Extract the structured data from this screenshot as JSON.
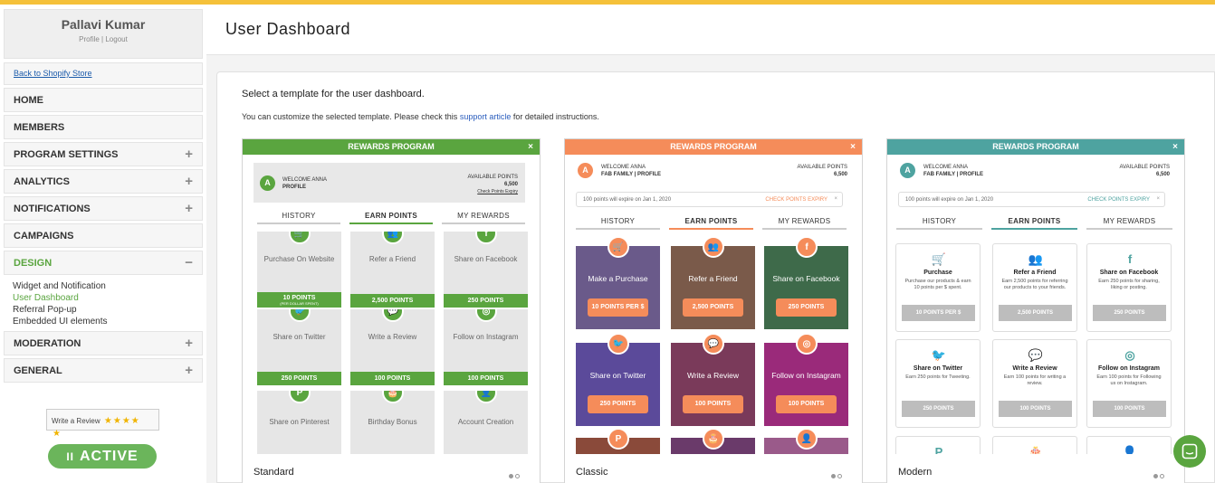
{
  "user": {
    "name": "Pallavi Kumar",
    "links": "Profile | Logout"
  },
  "sidebar": {
    "back": "Back to Shopify Store",
    "items": [
      {
        "label": "HOME",
        "pm": ""
      },
      {
        "label": "MEMBERS",
        "pm": ""
      },
      {
        "label": "PROGRAM SETTINGS",
        "pm": "+"
      },
      {
        "label": "ANALYTICS",
        "pm": "+"
      },
      {
        "label": "NOTIFICATIONS",
        "pm": "+"
      },
      {
        "label": "CAMPAIGNS",
        "pm": ""
      },
      {
        "label": "DESIGN",
        "pm": "−"
      },
      {
        "label": "MODERATION",
        "pm": "+"
      },
      {
        "label": "GENERAL",
        "pm": "+"
      }
    ],
    "design_sub": [
      "Widget and Notification",
      "User Dashboard",
      "Referral Pop-up",
      "Embedded UI elements"
    ],
    "review": "Write a Review",
    "review_stars": "★★★★",
    "review_star5": "★",
    "active": "ACTIVE",
    "active_icon": "II"
  },
  "header": {
    "title": "User Dashboard"
  },
  "panel": {
    "select": "Select a template for the user dashboard.",
    "desc_pre": "You can customize the selected template. Please check this ",
    "desc_link": "support article",
    "desc_post": " for detailed instructions."
  },
  "preview": {
    "rewards": "REWARDS PROGRAM",
    "close": "×",
    "welcome": "WELCOME ANNA",
    "profile": "PROFILE",
    "fab_profile": "FAB FAMILY | PROFILE",
    "avail": "AVAILABLE POINTS",
    "points": "6,500",
    "check": "Check Points Expiry",
    "expiry": "100 points will expire on Jan 1, 2020",
    "check_exp": "CHECK POINTS EXPIRY",
    "avatar": "A",
    "tabs": [
      "HISTORY",
      "EARN POINTS",
      "MY REWARDS"
    ]
  },
  "standard": {
    "caption": "Standard",
    "color": "#5aa53f",
    "tiles": [
      {
        "icon": "cart-icon",
        "g": "🛒",
        "label": "Purchase On Website",
        "pts": "10 POINTS",
        "sub": "(PER DOLLAR SPENT)"
      },
      {
        "icon": "refer-icon",
        "g": "👥",
        "label": "Refer a Friend",
        "pts": "2,500 POINTS",
        "sub": ""
      },
      {
        "icon": "facebook-icon",
        "g": "f",
        "label": "Share on Facebook",
        "pts": "250 POINTS",
        "sub": ""
      },
      {
        "icon": "twitter-icon",
        "g": "🐦",
        "label": "Share on Twitter",
        "pts": "250 POINTS",
        "sub": ""
      },
      {
        "icon": "review-icon",
        "g": "💬",
        "label": "Write a Review",
        "pts": "100 POINTS",
        "sub": ""
      },
      {
        "icon": "instagram-icon",
        "g": "◎",
        "label": "Follow on Instagram",
        "pts": "100 POINTS",
        "sub": ""
      },
      {
        "icon": "pinterest-icon",
        "g": "P",
        "label": "Share on Pinterest",
        "pts": "",
        "sub": ""
      },
      {
        "icon": "cake-icon",
        "g": "🎂",
        "label": "Birthday Bonus",
        "pts": "",
        "sub": ""
      },
      {
        "icon": "account-icon",
        "g": "👤",
        "label": "Account Creation",
        "pts": "",
        "sub": ""
      }
    ]
  },
  "classic": {
    "caption": "Classic",
    "color": "#f58c5a",
    "tiles": [
      {
        "icon": "cart-icon",
        "g": "🛒",
        "label": "Make a Purchase",
        "pts": "10 POINTS PER $",
        "bg": "#6a5a8a"
      },
      {
        "icon": "refer-icon",
        "g": "👥",
        "label": "Refer a Friend",
        "pts": "2,500 POINTS",
        "bg": "#7a5a4a"
      },
      {
        "icon": "facebook-icon",
        "g": "f",
        "label": "Share on Facebook",
        "pts": "250 POINTS",
        "bg": "#3e6a4a"
      },
      {
        "icon": "twitter-icon",
        "g": "🐦",
        "label": "Share on Twitter",
        "pts": "250 POINTS",
        "bg": "#5b4a9a"
      },
      {
        "icon": "review-icon",
        "g": "💬",
        "label": "Write a Review",
        "pts": "100 POINTS",
        "bg": "#7a3a5a"
      },
      {
        "icon": "instagram-icon",
        "g": "◎",
        "label": "Follow on Instagram",
        "pts": "100 POINTS",
        "bg": "#9a2a7a"
      },
      {
        "icon": "pinterest-icon",
        "g": "P",
        "label": "",
        "pts": "",
        "bg": "#8a4a3a"
      },
      {
        "icon": "cake-icon",
        "g": "🎂",
        "label": "",
        "pts": "",
        "bg": "#6a3a6a"
      },
      {
        "icon": "account-icon",
        "g": "👤",
        "label": "",
        "pts": "",
        "bg": "#9a5a8a"
      }
    ]
  },
  "modern": {
    "caption": "Modern",
    "color": "#4ea3a0",
    "tiles": [
      {
        "icon": "cart-icon",
        "g": "🛒",
        "label": "Purchase",
        "desc": "Purchase our products & earn 10 points per $ spent.",
        "pts": "10 POINTS PER $"
      },
      {
        "icon": "refer-icon",
        "g": "👥",
        "label": "Refer a Friend",
        "desc": "Earn 2,500 points for referring our products to your friends.",
        "pts": "2,500 POINTS"
      },
      {
        "icon": "facebook-icon",
        "g": "f",
        "label": "Share on Facebook",
        "desc": "Earn 250 points for sharing, liking or posting.",
        "pts": "250 POINTS"
      },
      {
        "icon": "twitter-icon",
        "g": "🐦",
        "label": "Share on Twitter",
        "desc": "Earn 250 points for Tweeting.",
        "pts": "250 POINTS"
      },
      {
        "icon": "review-icon",
        "g": "💬",
        "label": "Write a Review",
        "desc": "Earn 100 points for writing a review.",
        "pts": "100 POINTS"
      },
      {
        "icon": "instagram-icon",
        "g": "◎",
        "label": "Follow on Instagram",
        "desc": "Earn 100 points for Following us on Instagram.",
        "pts": "100 POINTS"
      },
      {
        "icon": "pinterest-icon",
        "g": "P",
        "label": "",
        "desc": "",
        "pts": ""
      },
      {
        "icon": "cake-icon",
        "g": "🎂",
        "label": "",
        "desc": "",
        "pts": ""
      },
      {
        "icon": "account-icon",
        "g": "👤",
        "label": "",
        "desc": "",
        "pts": ""
      }
    ]
  },
  "chat": {
    "icon": "chat-icon"
  }
}
